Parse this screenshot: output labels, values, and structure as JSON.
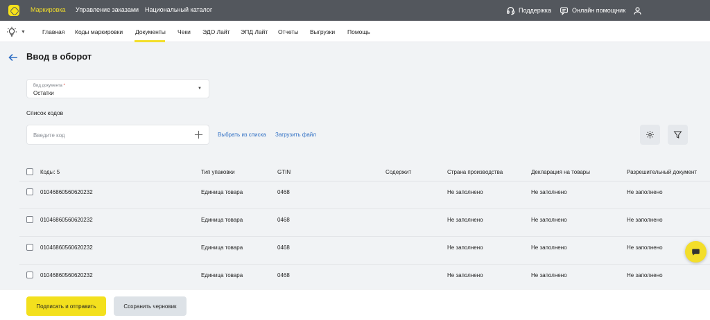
{
  "topbar": {
    "links": [
      "Маркировка",
      "Управление заказами",
      "Национальный каталог"
    ],
    "active_link": "Маркировка",
    "support_label": "Поддержка",
    "assistant_label": "Онлайн помощник",
    "accent_color": "#f3de2a",
    "background_color": "#53575d"
  },
  "nav": {
    "items": [
      "Главная",
      "Коды маркировки",
      "Документы",
      "Чеки",
      "ЭДО Лайт",
      "ЭПД Лайт",
      "Отчеты",
      "Выгрузки",
      "Помощь"
    ],
    "active_item": "Документы"
  },
  "page": {
    "title": "Ввод в оборот"
  },
  "doc_type": {
    "label": "Вид документа",
    "required_mark": "*",
    "value": "Остатки"
  },
  "codes": {
    "section_title": "Список кодов",
    "input_placeholder": "Введите код",
    "select_from_list": "Выбрать из списка",
    "upload_file": "Загрузить файл"
  },
  "table": {
    "columns": [
      "Коды: 5",
      "Тип упаковки",
      "GTIN",
      "Содержит",
      "Страна производства",
      "Декларация на товары",
      "Разрешительный документ"
    ],
    "rows": [
      [
        "01046860560620232",
        "Единица товара",
        "0468",
        "",
        "Не заполнено",
        "Не заполнено",
        "Не заполнено"
      ],
      [
        "01046860560620232",
        "Единица товара",
        "0468",
        "",
        "Не заполнено",
        "Не заполнено",
        "Не заполнено"
      ],
      [
        "01046860560620232",
        "Единица товара",
        "0468",
        "",
        "Не заполнено",
        "Не заполнено",
        "Не заполнено"
      ],
      [
        "01046860560620232",
        "Единица товара",
        "0468",
        "",
        "Не заполнено",
        "Не заполнено",
        "Не заполнено"
      ]
    ]
  },
  "footer": {
    "primary_label": "Подписать и отправить",
    "secondary_label": "Сохранить черновик"
  },
  "icons": {
    "logo": "marking-logo-icon",
    "support": "headset-icon",
    "assistant": "chat-icon",
    "profile": "user-icon",
    "bulb": "lightbulb-icon",
    "back": "arrow-left-icon",
    "add": "plus-icon",
    "settings": "gear-icon",
    "filter": "filter-icon",
    "chat_fab": "chat-bubble-icon"
  }
}
